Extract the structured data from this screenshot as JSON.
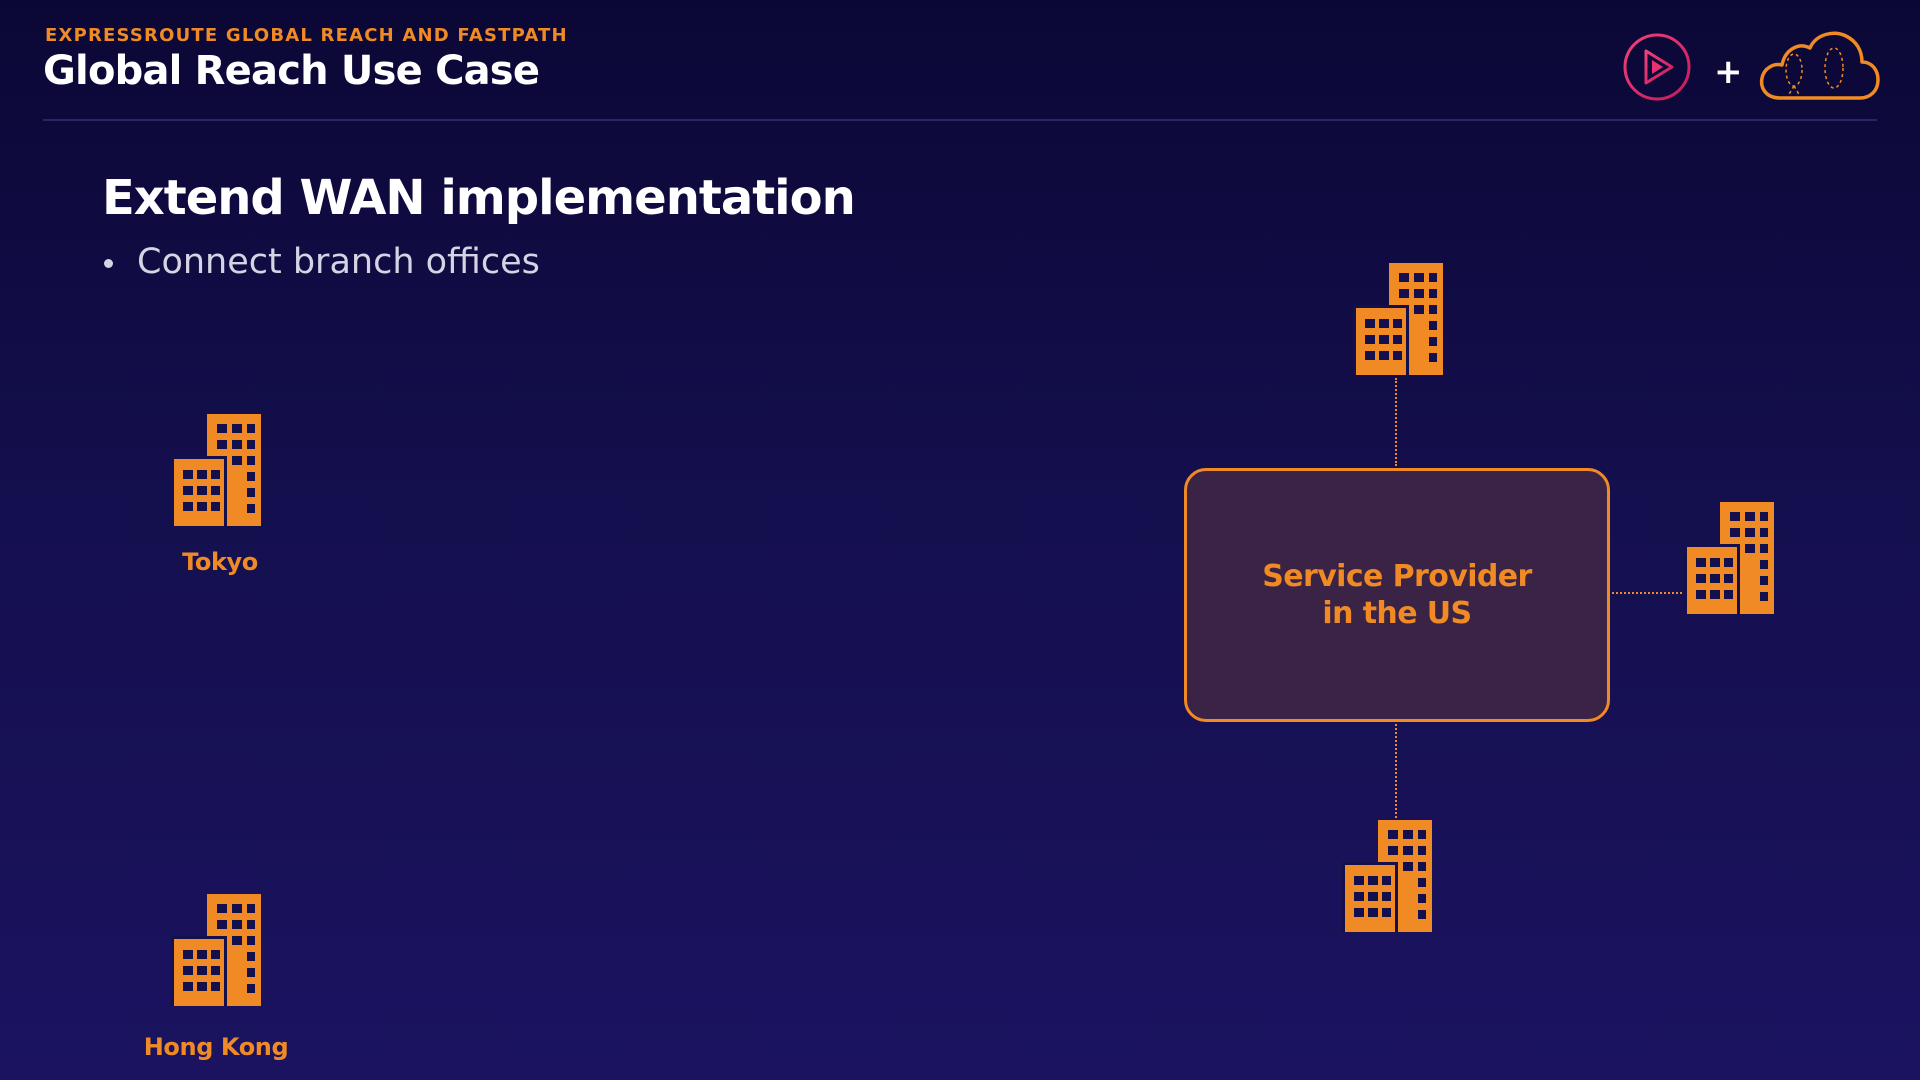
{
  "header": {
    "kicker": "EXPRESSROUTE GLOBAL REACH AND FASTPATH",
    "title": "Global Reach Use Case"
  },
  "logos": {
    "play": "play-logo-icon",
    "plus": "+",
    "cloud": "cloud-logo-icon"
  },
  "slide": {
    "heading": "Extend WAN implementation",
    "bullets": [
      "Connect branch offices"
    ]
  },
  "diagram": {
    "locations": [
      {
        "label": "Tokyo",
        "icon": "office-building-icon"
      },
      {
        "label": "Hong Kong",
        "icon": "office-building-icon"
      }
    ],
    "provider": {
      "label": "Service Provider\nin the US"
    },
    "branch_icons": [
      "office-building-icon",
      "office-building-icon",
      "office-building-icon"
    ]
  },
  "colors": {
    "accent": "#f08a24",
    "provider_fill": "#3a2344",
    "background_top": "#0b0735",
    "background_bottom": "#1b1360",
    "logo_play": "#e8326f"
  }
}
